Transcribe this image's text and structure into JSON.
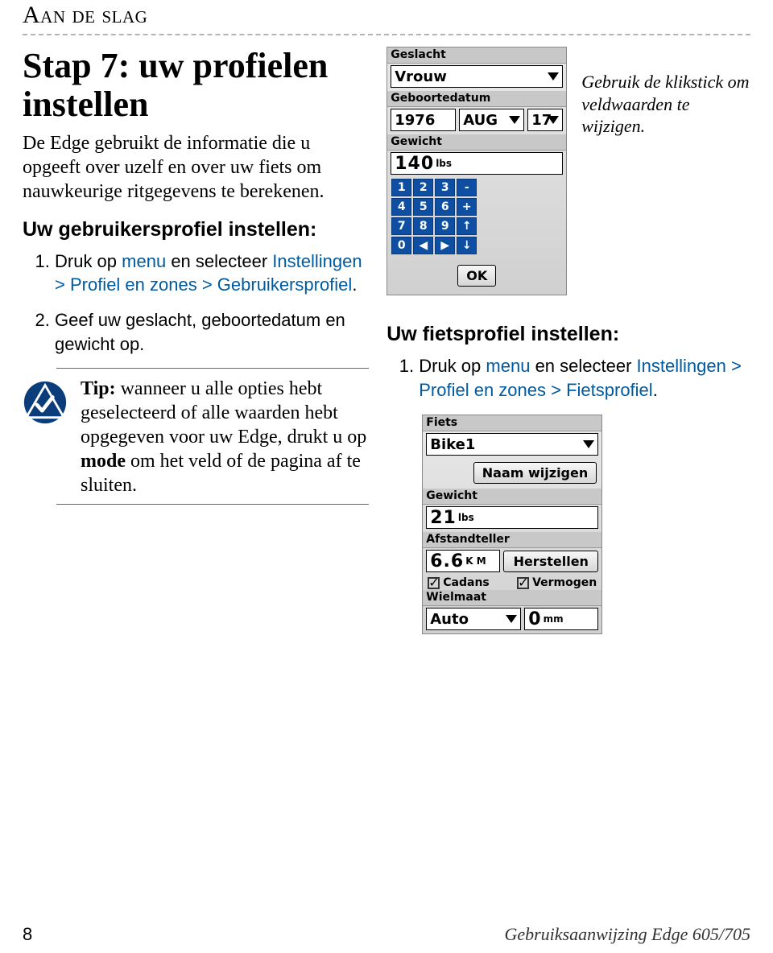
{
  "section_header": "Aan de slag",
  "title": "Stap 7: uw profielen instellen",
  "intro": "De Edge gebruikt de informatie die u opgeeft over uzelf en over uw fiets om nauwkeurige ritgegevens te berekenen.",
  "user_profile": {
    "heading": "Uw gebruikersprofiel instellen:",
    "step1_a": "Druk op ",
    "step1_menu": "menu",
    "step1_b": " en selecteer ",
    "step1_path": "Instellingen > Profiel en zones > Gebruikersprofiel",
    "step1_c": ".",
    "step2": "Geef uw geslacht, geboortedatum en gewicht op."
  },
  "tip": {
    "label": "Tip:",
    "body_a": " wanneer u alle opties hebt geselecteerd of alle waarden hebt opgegeven voor uw Edge, drukt u op ",
    "mode": "mode",
    "body_b": " om het veld of de pagina af te sluiten."
  },
  "caption": "Gebruik de klikstick om veldwaarden te wijzigen.",
  "bike_profile": {
    "heading": "Uw fietsprofiel instellen:",
    "step1_a": "Druk op ",
    "step1_menu": "menu",
    "step1_b": " en selecteer ",
    "step1_path": "Instellingen > Profiel en zones > Fietsprofiel",
    "step1_c": "."
  },
  "device1": {
    "l_geslacht": "Geslacht",
    "v_geslacht": "Vrouw",
    "l_gebdatum": "Geboortedatum",
    "v_year": "1976",
    "v_month": "AUG",
    "v_day": "17",
    "l_gewicht": "Gewicht",
    "v_gewicht": "140",
    "u_gewicht": "lbs",
    "keys": [
      "1",
      "2",
      "3",
      "-",
      "4",
      "5",
      "6",
      "+",
      "7",
      "8",
      "9",
      "↑",
      "0",
      "◀",
      "▶",
      "↓"
    ],
    "ok": "OK"
  },
  "device2": {
    "l_fiets": "Fiets",
    "v_fiets": "Bike1",
    "btn_naam": "Naam wijzigen",
    "l_gewicht": "Gewicht",
    "v_gewicht": "21",
    "u_gewicht": "lbs",
    "l_afstand": "Afstandteller",
    "v_afstand": "6.6",
    "u_afstand": "K M",
    "btn_herstel": "Herstellen",
    "chk_cadans": "Cadans",
    "chk_vermogen": "Vermogen",
    "l_wielmaat": "Wielmaat",
    "v_wiel_a": "Auto",
    "v_wiel_b": "0",
    "u_wiel_b": "mm"
  },
  "footer": {
    "page": "8",
    "text": "Gebruiksaanwijzing Edge 605/705"
  }
}
